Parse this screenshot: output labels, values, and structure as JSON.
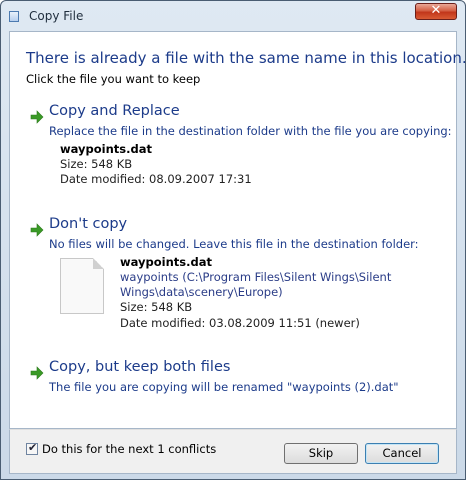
{
  "window": {
    "title": "Copy File",
    "close_symbol": "✕"
  },
  "header": {
    "heading": "There is already a file with the same name in this location.",
    "subtext": "Click the file you want to keep"
  },
  "options": {
    "replace": {
      "title": "Copy and Replace",
      "description": "Replace the file in the destination folder with the file you are copying:",
      "file_name": "waypoints.dat",
      "size": "Size: 548 KB",
      "date": "Date modified: 08.09.2007 17:31"
    },
    "dont_copy": {
      "title": "Don't copy",
      "description": "No files will be changed. Leave this file in the destination folder:",
      "file_name": "waypoints.dat",
      "path_line1": "waypoints (C:\\Program Files\\Silent Wings\\Silent",
      "path_line2": "Wings\\data\\scenery\\Europe)",
      "size": "Size: 548 KB",
      "date": "Date modified: 03.08.2009 11:51 (newer)"
    },
    "keep_both": {
      "title": "Copy, but keep both files",
      "description": "The file you are copying will be renamed \"waypoints (2).dat\""
    }
  },
  "footer": {
    "checkbox_checked": true,
    "checkbox_label": "Do this for the next 1 conflicts",
    "skip_label": "Skip",
    "cancel_label": "Cancel"
  },
  "colors": {
    "accent": "#1c3b8a",
    "arrow": "#3a9a26"
  },
  "icons": [
    "app-icon",
    "arrow-icon",
    "file-icon",
    "close-icon",
    "check-icon"
  ]
}
